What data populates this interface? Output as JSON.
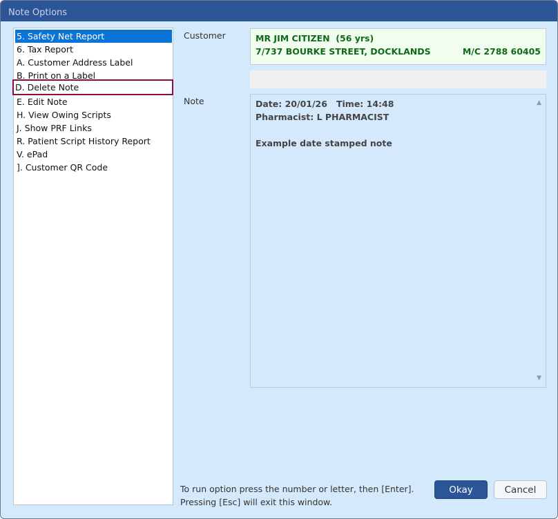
{
  "window": {
    "title": "Note Options"
  },
  "options": [
    "5. Safety Net Report",
    "6. Tax Report",
    "A. Customer Address Label",
    "B. Print on a Label",
    "D. Delete Note",
    "E. Edit Note",
    "H. View Owing Scripts",
    "J. Show PRF Links",
    "R. Patient Script History Report",
    "V. ePad",
    "]. Customer QR Code"
  ],
  "customer": {
    "label": "Customer",
    "name": "MR JIM CITIZEN  (56 yrs)",
    "address": "7/737 BOURKE STREET, DOCKLANDS",
    "medicare": "M/C 2788 60405"
  },
  "note": {
    "label": "Note",
    "line1": "Date: 20/01/26   Time: 14:48",
    "line2": "Pharmacist: L PHARMACIST",
    "line3": "Example date stamped note"
  },
  "footer": {
    "line1": "To run option press the number or letter, then [Enter].",
    "line2": "Pressing [Esc] will exit this window."
  },
  "buttons": {
    "okay": "Okay",
    "cancel": "Cancel"
  }
}
